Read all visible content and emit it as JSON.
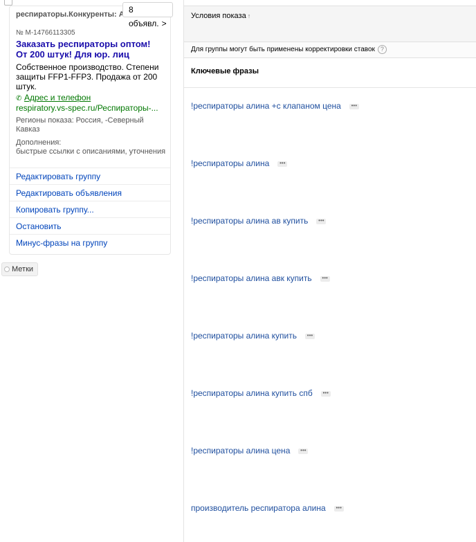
{
  "group": {
    "ads_count_label": "8 объявл.",
    "ads_count_chevron": ">",
    "name": "респираторы.Конкуренты: Алина",
    "ad_id": "№ М-14766113305",
    "title": "Заказать респираторы оптом! От 200 штук! Для юр. лиц",
    "text": "Собственное производство. Степени защиты FFP1-FFP3. Продажа от 200 штук.",
    "contacts_label": "Адрес и телефон",
    "url": "respiratory.vs-spec.ru/Респираторы-...",
    "regions": "Регионы показа: Россия, -Северный Кавказ",
    "extras_title": "Дополнения:",
    "extras": "быстрые ссылки с описаниями, уточнения",
    "actions": [
      "Редактировать группу",
      "Редактировать объявления",
      "Копировать группу...",
      "Остановить",
      "Минус-фразы на группу"
    ],
    "tags_label": "Метки"
  },
  "conditions": {
    "title": "Условия показа",
    "sort_icon": "↑",
    "adjustments_note": "Для группы могут быть применены корректировки ставок",
    "help_icon": "?",
    "keywords_title": "Ключевые фразы",
    "more_icon": "•••",
    "keywords": [
      "!респираторы алина +с клапаном цена",
      "!респираторы алина",
      "!респираторы алина ав купить",
      "!респираторы алина авк купить",
      "!респираторы алина купить",
      "!респираторы алина купить спб",
      "!респираторы алина цена",
      "производитель респиратора алина"
    ]
  },
  "icons": {
    "phone": "phone-icon",
    "chevron": "chevron-right-icon",
    "sort": "sort-arrow-icon",
    "help": "help-icon",
    "more": "more-icon",
    "tag": "tag-icon"
  },
  "colors": {
    "ad_title": "#1a0dab",
    "link": "#0044bb",
    "url_green": "#007700",
    "keyword_link": "#1e4e9e"
  }
}
